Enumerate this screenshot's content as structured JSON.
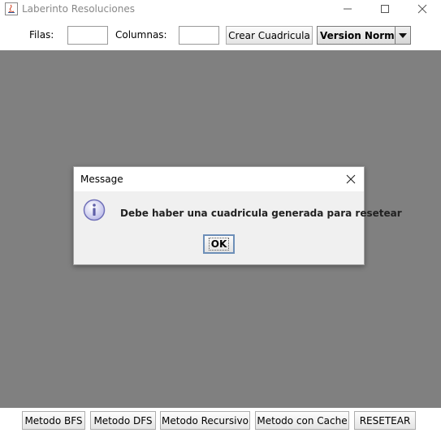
{
  "window": {
    "title": "Laberinto Resoluciones",
    "icons": [
      "java-app-icon",
      "minimize-icon",
      "maximize-icon",
      "close-icon"
    ]
  },
  "toolbar": {
    "rows_label": "Filas:",
    "rows_value": "",
    "columns_label": "Columnas:",
    "columns_value": "",
    "create_grid_label": "Crear Cuadricula",
    "version_select": {
      "selected": "Version Normal"
    }
  },
  "bottom_buttons": {
    "bfs": "Metodo BFS",
    "dfs": "Metodo DFS",
    "recursive": "Metodo Recursivo",
    "cache": "Metodo con Cache",
    "reset": "RESETEAR"
  },
  "dialog": {
    "title": "Message",
    "message": "Debe haber una cuadricula generada para resetear",
    "ok_label": "OK",
    "icon": "info-icon"
  },
  "colors": {
    "main_area": "#808080",
    "dialog_bg": "#f0f0f0",
    "ok_border": "#6d8fb8"
  }
}
